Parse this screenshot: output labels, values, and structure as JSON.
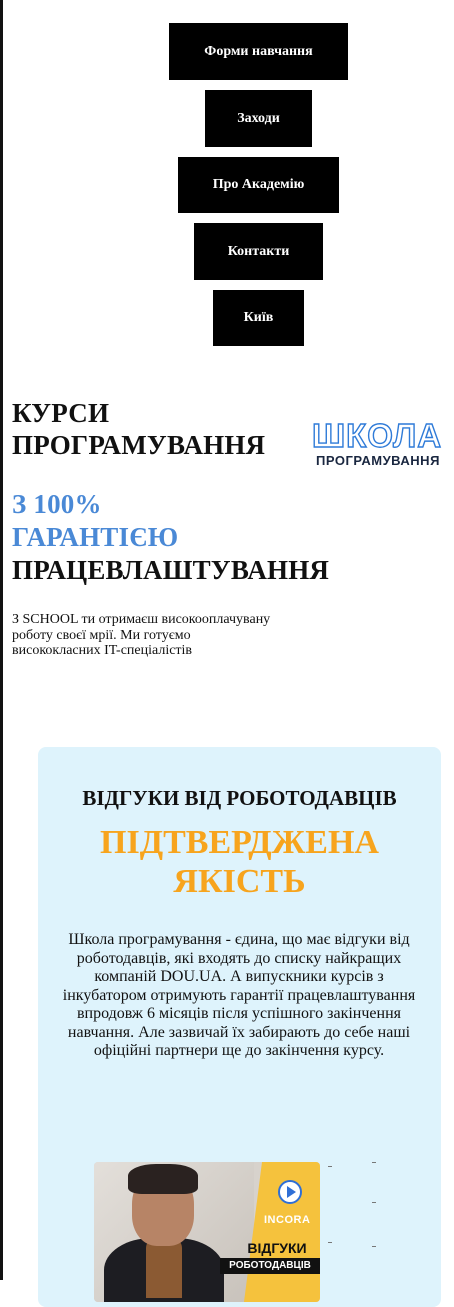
{
  "nav": {
    "items": [
      "Форми навчання",
      "Заходи",
      "Про Академію",
      "Контакти",
      "Київ"
    ]
  },
  "hero": {
    "title_line1": "КУРСИ",
    "title_line2": "ПРОГРАМУВАННЯ",
    "accent_line1": "З 100%",
    "accent_line2": "ГАРАНТІЄЮ",
    "title_line3": "ПРАЦЕВЛАШТУВАННЯ",
    "description": "З SCHOOL ти отримаєш високооплачувану роботу своєї мрії. Ми готуємо висококласних IT-спеціалістів"
  },
  "logo": {
    "top": "ШКОЛА",
    "bottom": "ПРОГРАМУВАННЯ"
  },
  "reviews": {
    "title": "ВІДГУКИ ВІД РОБОТОДАВЦІВ",
    "subtitle_line1": "ПІДТВЕРДЖЕНА",
    "subtitle_line2": "ЯКІСТЬ",
    "text": "Школа програмування - єдина, що має відгуки від роботодавців, які входять до списку найкращих компаній DOU.UA. А випускники курсів з інкубатором отримують гарантії працевлаштування впродовж 6 місяців після успішного закінчення навчання. Але зазвичай їх забирають до себе наші офіційні партнери ще до закінчення курсу.",
    "video": {
      "brand": "INCORA",
      "label1": "ВІДГУКИ",
      "label2": "РОБОТОДАВЦІВ"
    }
  },
  "colors": {
    "accent_blue": "#4a89d6",
    "accent_orange": "#f7a41d",
    "card_bg": "#def3fc",
    "nav_bg": "#000000"
  }
}
